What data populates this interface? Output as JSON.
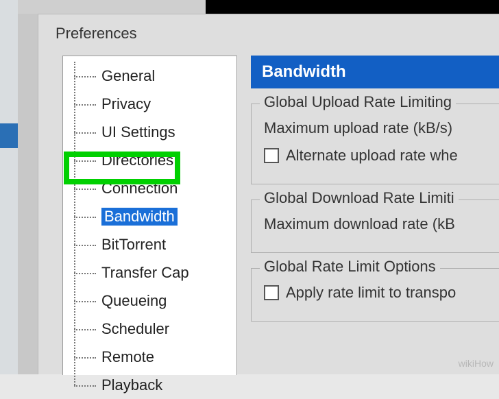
{
  "window": {
    "title": "Preferences"
  },
  "tree": {
    "items": [
      {
        "label": "General"
      },
      {
        "label": "Privacy"
      },
      {
        "label": "UI Settings"
      },
      {
        "label": "Directories"
      },
      {
        "label": "Connection"
      },
      {
        "label": "Bandwidth",
        "selected": true,
        "highlighted": true
      },
      {
        "label": "BitTorrent"
      },
      {
        "label": "Transfer Cap"
      },
      {
        "label": "Queueing"
      },
      {
        "label": "Scheduler"
      },
      {
        "label": "Remote"
      },
      {
        "label": "Playback"
      }
    ]
  },
  "content": {
    "header": "Bandwidth",
    "group_upload": {
      "legend": "Global Upload Rate Limiting",
      "max_label": "Maximum upload rate (kB/s)",
      "alt_label": "Alternate upload rate whe"
    },
    "group_download": {
      "legend": "Global Download Rate Limiti",
      "max_label": "Maximum download rate (kB"
    },
    "group_options": {
      "legend": "Global Rate Limit Options",
      "apply_label": "Apply rate limit to transpo"
    }
  },
  "watermark": "wikiHow"
}
